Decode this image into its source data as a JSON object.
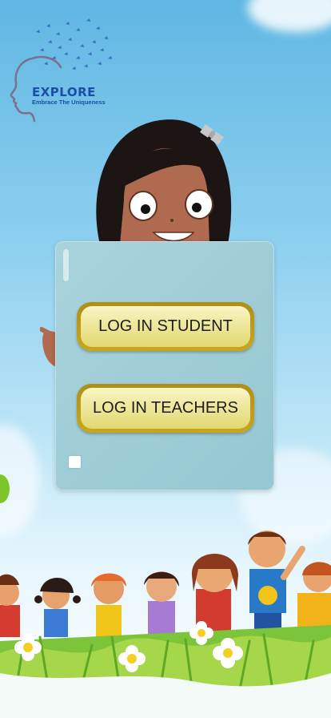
{
  "logo": {
    "title": "EXPLORE",
    "tagline": "Embrace The Uniqueness"
  },
  "buttons": {
    "student_label": "LOG IN STUDENT",
    "teachers_label": "LOG IN TEACHERS"
  },
  "colors": {
    "sky": "#5fb7e3",
    "board": "#a9d3dc",
    "button_gold": "#caa61c",
    "button_face": "#f2eda8",
    "logo_blue": "#1a4fa3"
  }
}
